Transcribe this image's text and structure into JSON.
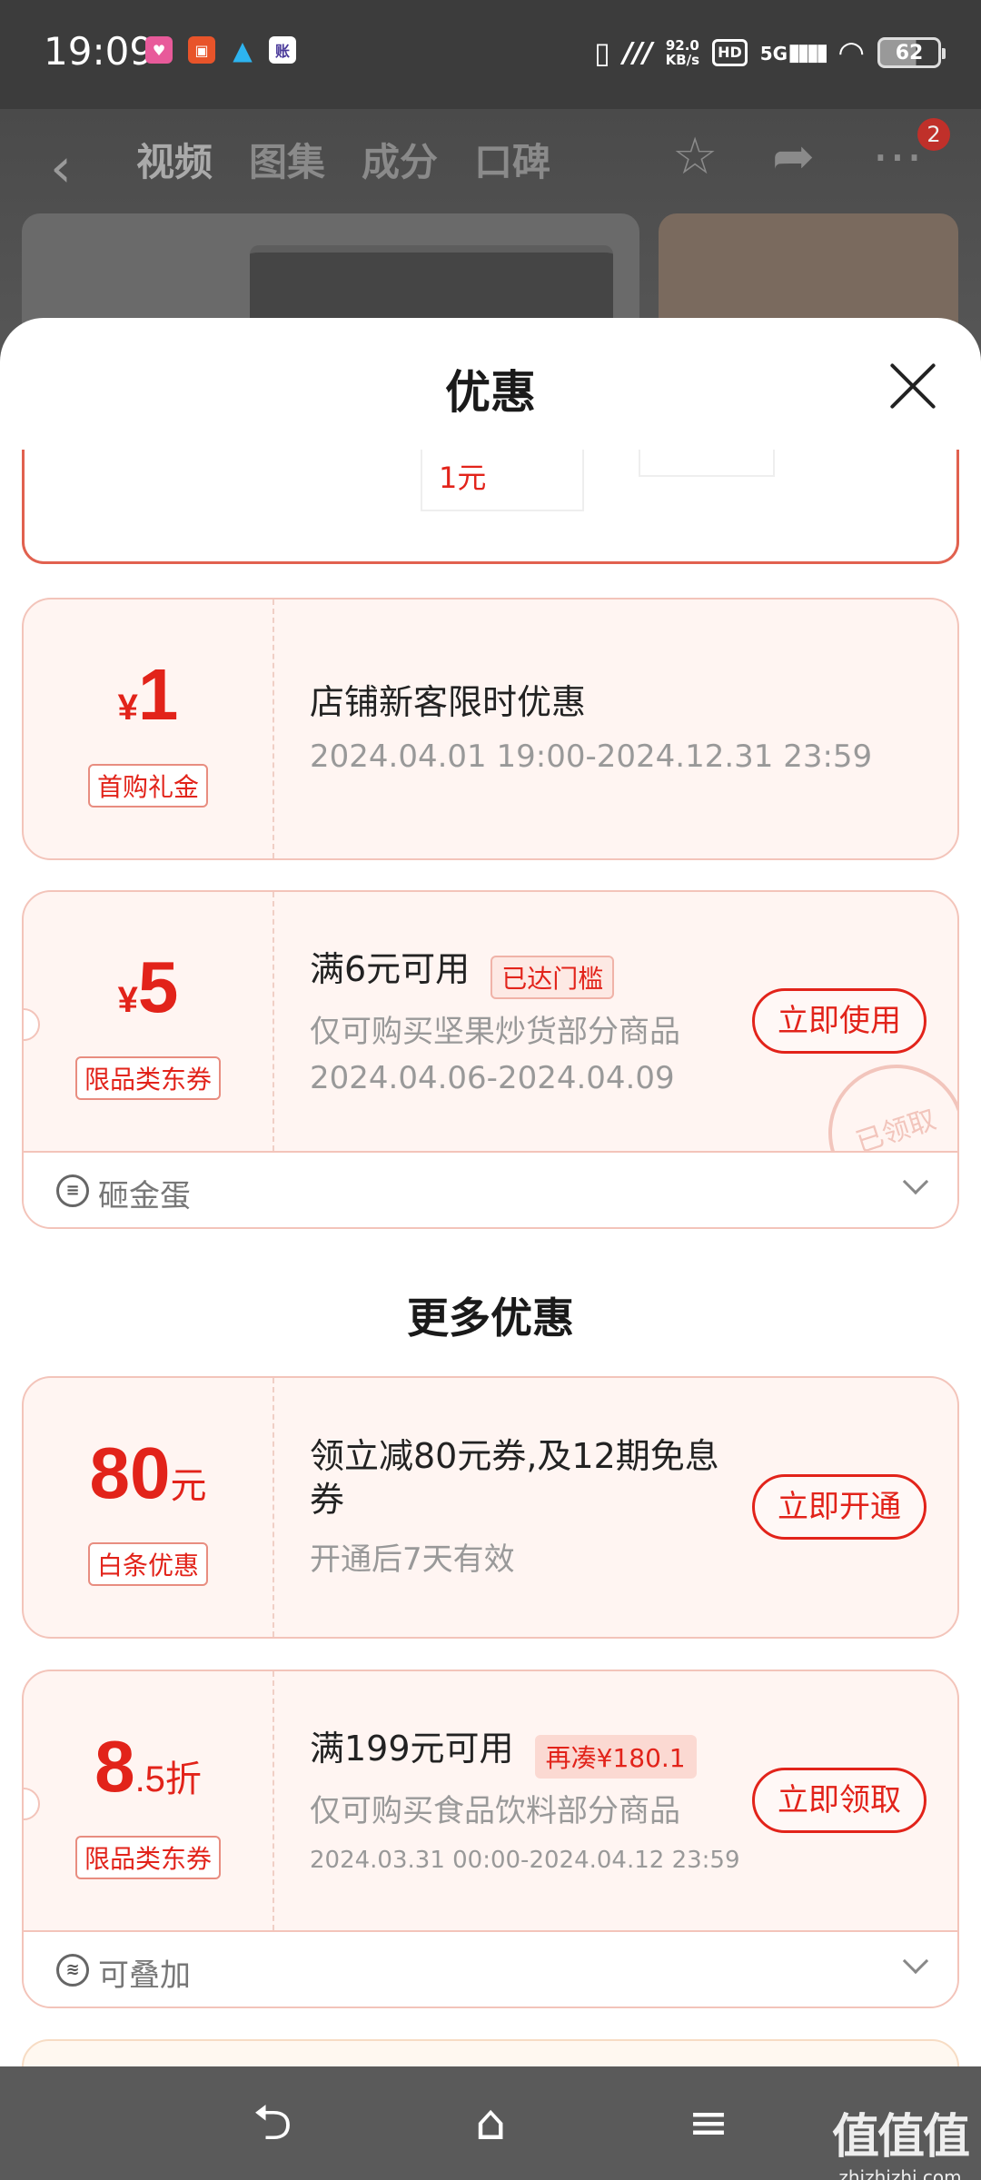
{
  "status_bar": {
    "time": "19:09",
    "apps": [
      "Lele",
      "IQ",
      "QQ",
      "账"
    ],
    "speed_value": "92.0",
    "speed_unit": "KB/s",
    "hd": "HD",
    "network": "5G",
    "battery": "62"
  },
  "background_page": {
    "tabs": [
      "视频",
      "图集",
      "成分",
      "口碑"
    ],
    "badge": "2"
  },
  "sheet": {
    "title": "优惠",
    "partial_value": "1元",
    "coupons": [
      {
        "currency": "¥",
        "amount": "1",
        "tag": "首购礼金",
        "title": "店铺新客限时优惠",
        "date": "2024.04.01 19:00-2024.12.31 23:59"
      },
      {
        "currency": "¥",
        "amount": "5",
        "tag": "限品类东券",
        "title": "满6元可用",
        "flag": "已达门槛",
        "desc": "仅可购买坚果炒货部分商品",
        "date": "2024.04.06-2024.04.09",
        "button": "立即使用",
        "stamp": "已领取",
        "footer": "砸金蛋"
      }
    ],
    "more_title": "更多优惠",
    "more_coupons": [
      {
        "amount": "80",
        "unit": "元",
        "tag": "白条优惠",
        "title": "领立减80元券,及12期免息券",
        "desc": "开通后7天有效",
        "button": "立即开通"
      },
      {
        "amount": "8",
        "unit": ".5折",
        "tag": "限品类东券",
        "title": "满199元可用",
        "flag": "再凑¥180.1",
        "desc": "仅可购买食品饮料部分商品",
        "date": "2024.03.31 00:00-2024.04.12 23:59",
        "button": "立即领取",
        "footer": "可叠加"
      }
    ]
  },
  "watermark": {
    "main": "值值值",
    "sub": "zhizhizhi.com"
  },
  "colors": {
    "accent": "#e2231a",
    "coupon_bg": "#fff5f2",
    "coupon_border": "#f3c4ba"
  }
}
